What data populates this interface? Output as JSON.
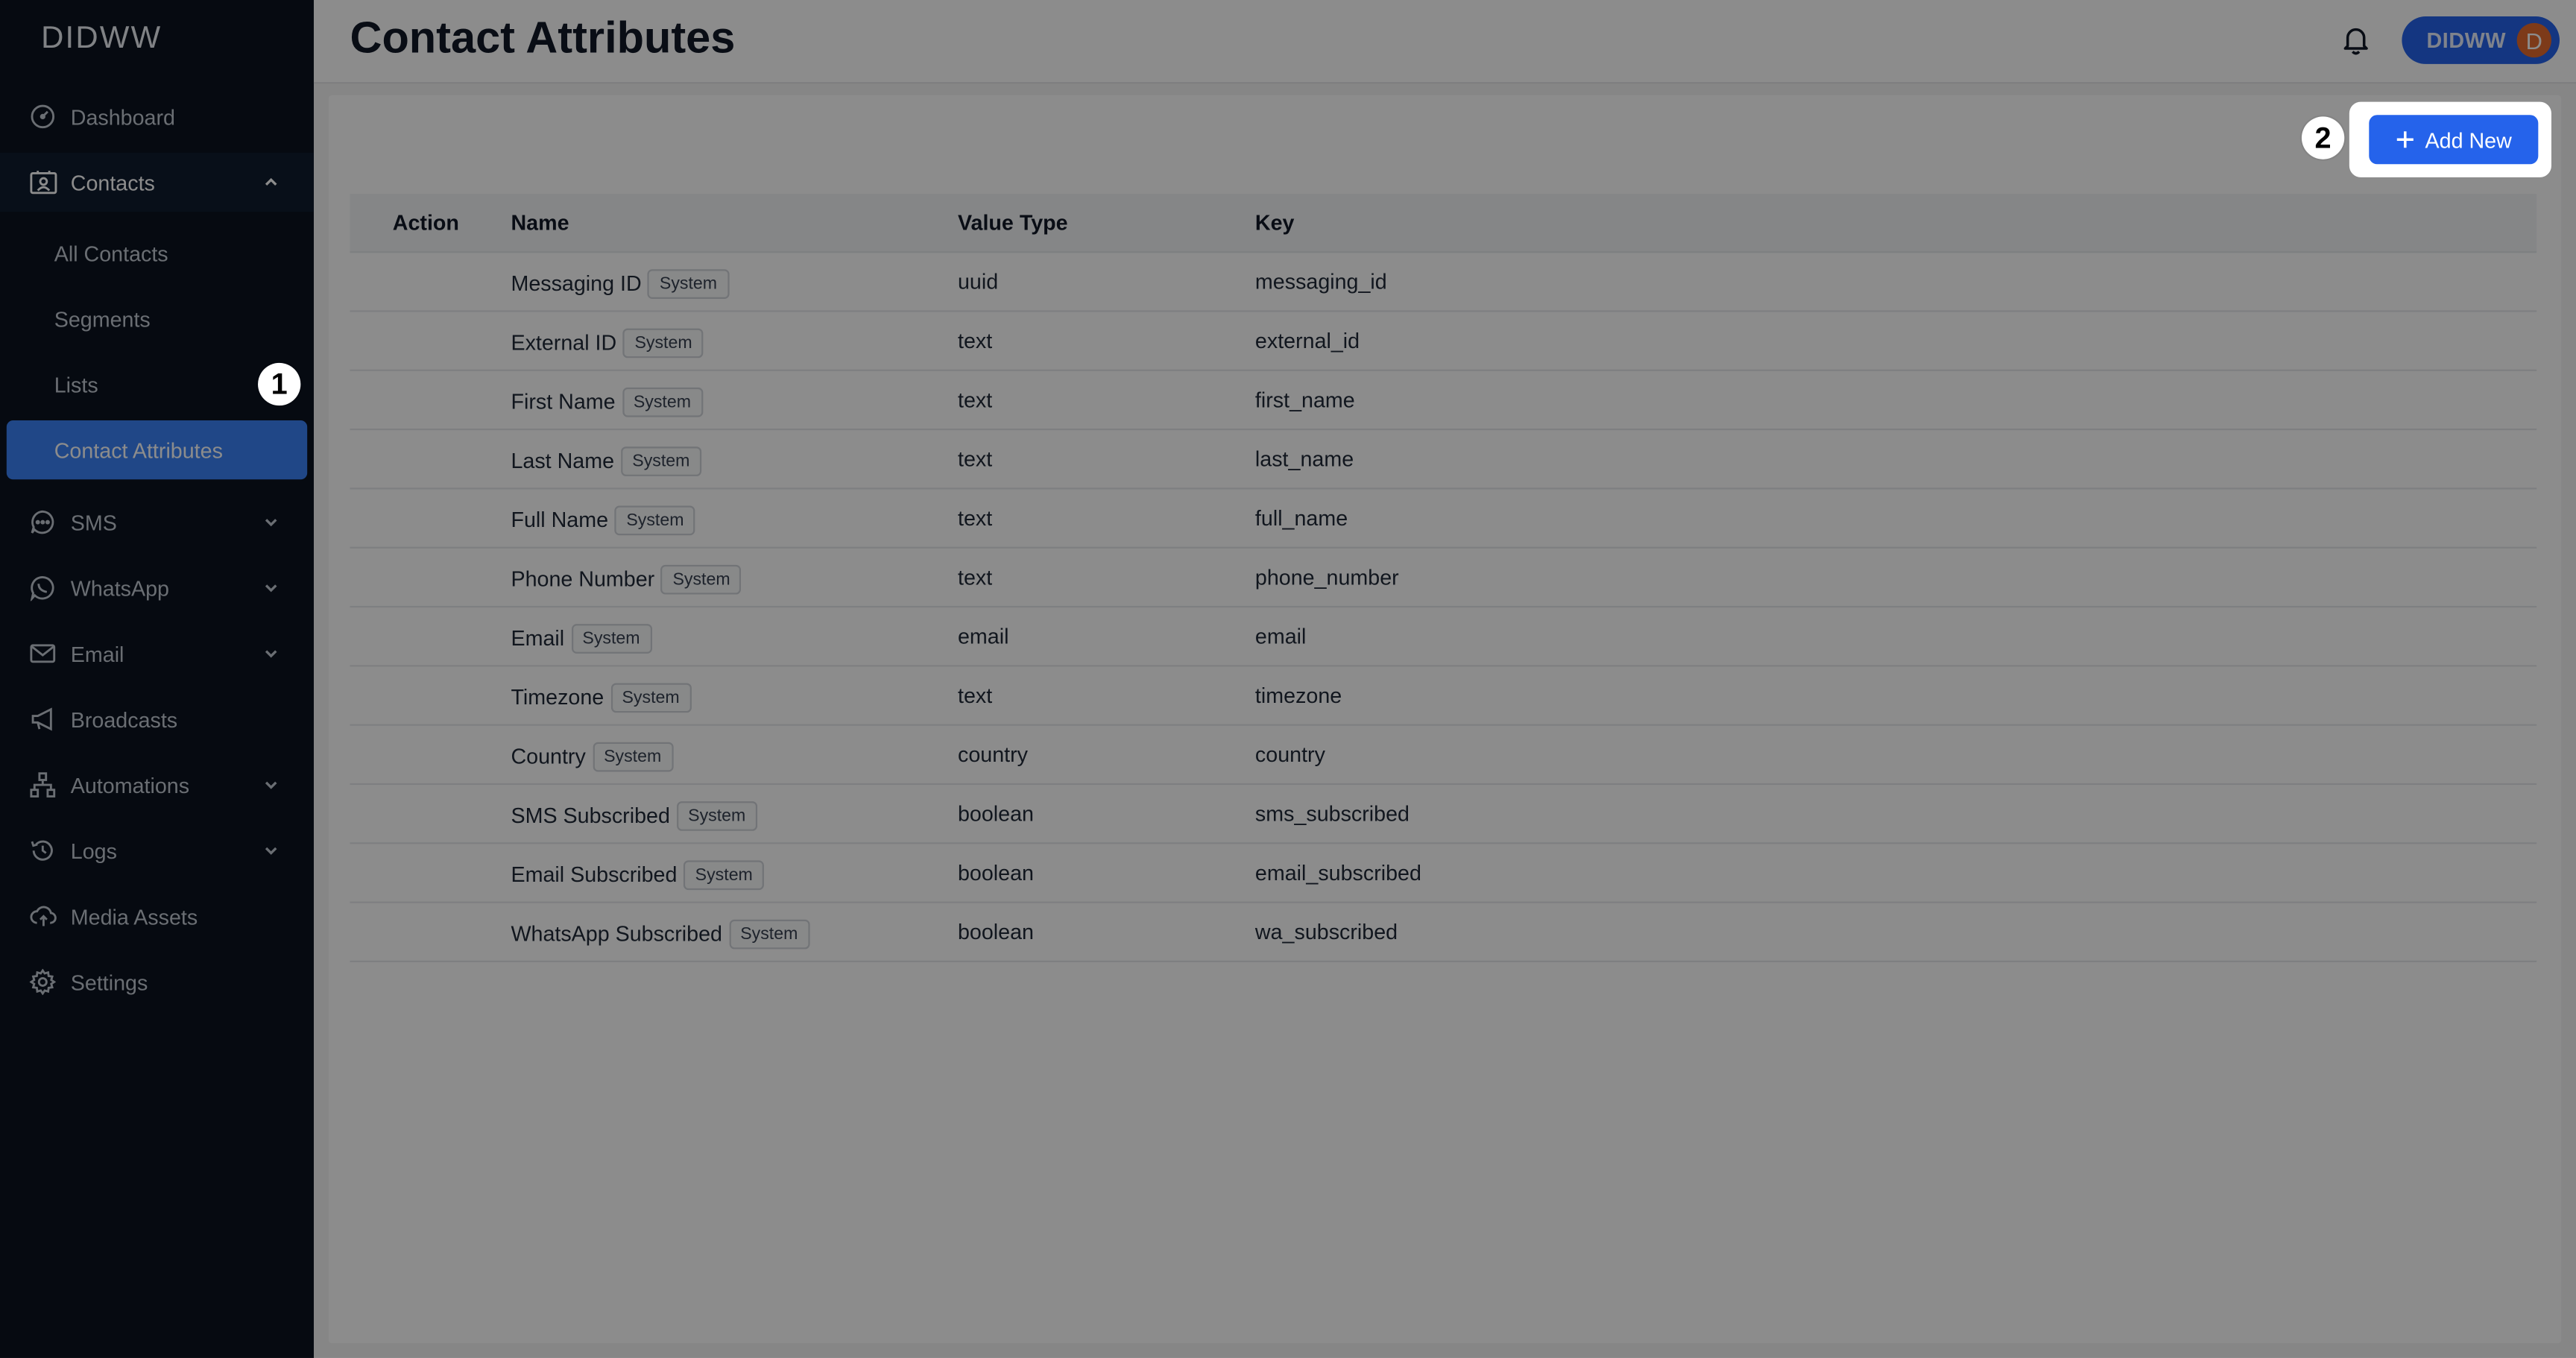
{
  "brand": "DIDWW",
  "header": {
    "title": "Contact Attributes",
    "account_name": "DIDWW",
    "avatar_initial": "D"
  },
  "sidebar": {
    "items": [
      {
        "label": "Dashboard",
        "icon": "dashboard-icon"
      },
      {
        "label": "Contacts",
        "icon": "contacts-icon",
        "expanded": true
      },
      {
        "label": "SMS",
        "icon": "sms-icon"
      },
      {
        "label": "WhatsApp",
        "icon": "whatsapp-icon"
      },
      {
        "label": "Email",
        "icon": "email-icon"
      },
      {
        "label": "Broadcasts",
        "icon": "megaphone-icon"
      },
      {
        "label": "Automations",
        "icon": "automations-icon"
      },
      {
        "label": "Logs",
        "icon": "history-icon"
      },
      {
        "label": "Media Assets",
        "icon": "cloud-upload-icon"
      },
      {
        "label": "Settings",
        "icon": "gear-icon"
      }
    ],
    "contacts_sub": [
      "All Contacts",
      "Segments",
      "Lists",
      "Contact Attributes"
    ],
    "active_sub": "Contact Attributes"
  },
  "toolbar": {
    "add_label": "Add New"
  },
  "table": {
    "columns": [
      "Action",
      "Name",
      "Value Type",
      "Key"
    ],
    "rows": [
      {
        "name": "Messaging ID",
        "badge": "System",
        "type": "uuid",
        "key": "messaging_id"
      },
      {
        "name": "External ID",
        "badge": "System",
        "type": "text",
        "key": "external_id"
      },
      {
        "name": "First Name",
        "badge": "System",
        "type": "text",
        "key": "first_name"
      },
      {
        "name": "Last Name",
        "badge": "System",
        "type": "text",
        "key": "last_name"
      },
      {
        "name": "Full Name",
        "badge": "System",
        "type": "text",
        "key": "full_name"
      },
      {
        "name": "Phone Number",
        "badge": "System",
        "type": "text",
        "key": "phone_number"
      },
      {
        "name": "Email",
        "badge": "System",
        "type": "email",
        "key": "email"
      },
      {
        "name": "Timezone",
        "badge": "System",
        "type": "text",
        "key": "timezone"
      },
      {
        "name": "Country",
        "badge": "System",
        "type": "country",
        "key": "country"
      },
      {
        "name": "SMS Subscribed",
        "badge": "System",
        "type": "boolean",
        "key": "sms_subscribed"
      },
      {
        "name": "Email Subscribed",
        "badge": "System",
        "type": "boolean",
        "key": "email_subscribed"
      },
      {
        "name": "WhatsApp Subscribed",
        "badge": "System",
        "type": "boolean",
        "key": "wa_subscribed"
      }
    ]
  },
  "markers": [
    "1",
    "2"
  ],
  "colors": {
    "accent": "#3b82f6",
    "sidebar_bg": "#0b1320",
    "overlay": "rgba(0,0,0,0.45)"
  }
}
